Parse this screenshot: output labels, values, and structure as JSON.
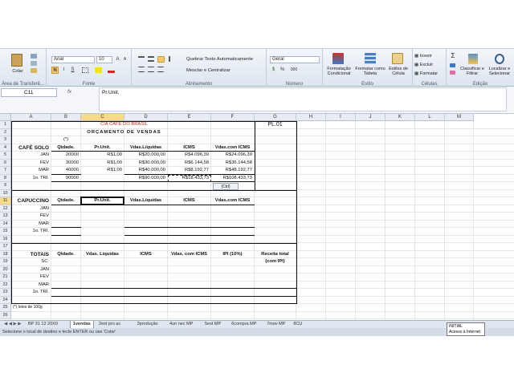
{
  "ribbon": {
    "clipboard": {
      "paste": "Colar",
      "group": "Área de Transferê..."
    },
    "font": {
      "name": "Arial",
      "size": "10",
      "bold": "N",
      "italic": "I",
      "underline": "S",
      "group": "Fonte"
    },
    "alignment": {
      "wrap": "Quebrar Texto Automaticamente",
      "merge": "Mesclar e Centralizar",
      "group": "Alinhamento"
    },
    "number": {
      "format": "Geral",
      "percent": "%",
      "thousands": "000",
      "group": "Número"
    },
    "styles": {
      "conditional": "Formatação Condicional",
      "table": "Formatar como Tabela",
      "cell": "Estilos de Célula",
      "group": "Estilo"
    },
    "cells": {
      "insert": "Inserir",
      "delete": "Excluir",
      "format": "Formatar",
      "group": "Células"
    },
    "editing": {
      "sum": "Σ",
      "sort": "Classificar e Filtrar",
      "find": "Localizar e Selecionar",
      "group": "Edição"
    }
  },
  "formula_bar": {
    "name_box": "C11",
    "fx": "fx",
    "content": "Pr.Unit."
  },
  "columns": [
    "A",
    "B",
    "C",
    "D",
    "E",
    "F",
    "G",
    "H",
    "I",
    "J",
    "K",
    "L",
    "M"
  ],
  "rows": [
    "1",
    "2",
    "3",
    "4",
    "5",
    "6",
    "7",
    "8",
    "9",
    "10",
    "11",
    "12",
    "13",
    "14",
    "15",
    "16",
    "17",
    "18",
    "19",
    "20",
    "21",
    "22",
    "23",
    "24",
    "25",
    "26"
  ],
  "sheet": {
    "c1": "CIA CAFÉ DO BRASIL",
    "g1": "PL.01",
    "c2": "ORÇAMENTO DE VENDAS",
    "b3": "(*)",
    "a4": "CAFÉ SOLO",
    "b4": "Qtdade.",
    "c4": "Pr.Unit.",
    "d4": "Vdas.Líquidas",
    "e4": "ICMS",
    "f4": "Vdas.com ICMS",
    "a5": "JAN",
    "b5": "20000",
    "c5": "R$1,00",
    "d5": "R$20.000,00",
    "e5": "R$4.096,39",
    "f5": "R$24.096,39",
    "a6": "FEV",
    "b6": "30000",
    "c6": "R$1,00",
    "d6": "R$30.000,00",
    "e6": "R$6.144,58",
    "f6": "R$36.144,58",
    "a7": "MAR",
    "b7": "40000",
    "c7": "R$1,00",
    "d7": "R$40.000,00",
    "e7": "R$8.192,77",
    "f7": "R$48.192,77",
    "a8": "1o. TRI.",
    "b8": "90000",
    "d8": "R$90.000,00",
    "e8": "R$18.433,73",
    "f8": "R$108.433,73",
    "paste_options": "(Ctrl)",
    "a11": "CAPUCCINO",
    "b11": "Qtdade.",
    "c11": "Pr.Unit.",
    "d11": "Vdas.Líquidas",
    "e11": "ICMS",
    "f11": "Vdas.com ICMS",
    "a12": "JAN",
    "a13": "FEV",
    "a14": "MAR",
    "a15": "1o. TRI.",
    "a18": "TOTAIS",
    "b18": "Qtdade.",
    "c18": "Vdas. Líquidas",
    "d18": "ICMS",
    "e18": "Vdas. com ICMS",
    "f18": "IPI (10%)",
    "g18": "Receita total",
    "g19": "(com IPI)",
    "a19": "SC:",
    "a20": "JAN",
    "a21": "FEV",
    "a22": "MAR",
    "a23": "1o. TRI.",
    "a25": "(*) lotes de 100g"
  },
  "tabs": [
    "BP 31 12 20X0",
    "1vendas",
    "2est pro ac",
    "3produção",
    "4un nec MP",
    "5est MP",
    "6compra MP",
    "7mov MP",
    "8CU"
  ],
  "active_tab": "1vendas",
  "status": "Selecione o local de destino e tecle ENTER ou use 'Colar'",
  "tooltip": {
    "line1": "INITIAL",
    "line2": "Acesso à Internet"
  }
}
